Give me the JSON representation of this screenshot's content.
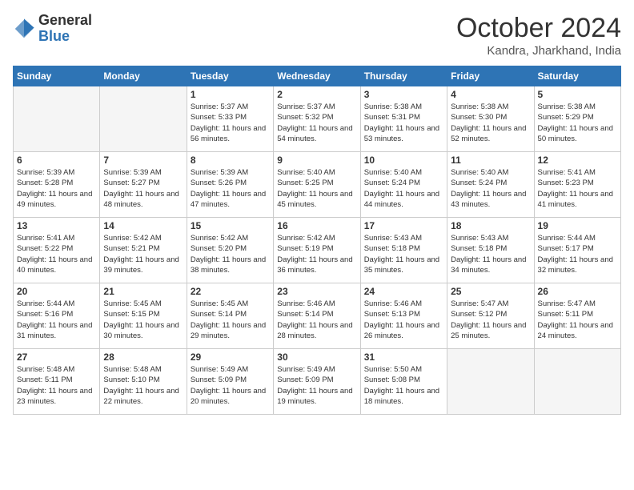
{
  "header": {
    "logo_general": "General",
    "logo_blue": "Blue",
    "month_year": "October 2024",
    "location": "Kandra, Jharkhand, India"
  },
  "days_of_week": [
    "Sunday",
    "Monday",
    "Tuesday",
    "Wednesday",
    "Thursday",
    "Friday",
    "Saturday"
  ],
  "weeks": [
    [
      {
        "day": "",
        "details": ""
      },
      {
        "day": "",
        "details": ""
      },
      {
        "day": "1",
        "details": "Sunrise: 5:37 AM\nSunset: 5:33 PM\nDaylight: 11 hours and 56 minutes."
      },
      {
        "day": "2",
        "details": "Sunrise: 5:37 AM\nSunset: 5:32 PM\nDaylight: 11 hours and 54 minutes."
      },
      {
        "day": "3",
        "details": "Sunrise: 5:38 AM\nSunset: 5:31 PM\nDaylight: 11 hours and 53 minutes."
      },
      {
        "day": "4",
        "details": "Sunrise: 5:38 AM\nSunset: 5:30 PM\nDaylight: 11 hours and 52 minutes."
      },
      {
        "day": "5",
        "details": "Sunrise: 5:38 AM\nSunset: 5:29 PM\nDaylight: 11 hours and 50 minutes."
      }
    ],
    [
      {
        "day": "6",
        "details": "Sunrise: 5:39 AM\nSunset: 5:28 PM\nDaylight: 11 hours and 49 minutes."
      },
      {
        "day": "7",
        "details": "Sunrise: 5:39 AM\nSunset: 5:27 PM\nDaylight: 11 hours and 48 minutes."
      },
      {
        "day": "8",
        "details": "Sunrise: 5:39 AM\nSunset: 5:26 PM\nDaylight: 11 hours and 47 minutes."
      },
      {
        "day": "9",
        "details": "Sunrise: 5:40 AM\nSunset: 5:25 PM\nDaylight: 11 hours and 45 minutes."
      },
      {
        "day": "10",
        "details": "Sunrise: 5:40 AM\nSunset: 5:24 PM\nDaylight: 11 hours and 44 minutes."
      },
      {
        "day": "11",
        "details": "Sunrise: 5:40 AM\nSunset: 5:24 PM\nDaylight: 11 hours and 43 minutes."
      },
      {
        "day": "12",
        "details": "Sunrise: 5:41 AM\nSunset: 5:23 PM\nDaylight: 11 hours and 41 minutes."
      }
    ],
    [
      {
        "day": "13",
        "details": "Sunrise: 5:41 AM\nSunset: 5:22 PM\nDaylight: 11 hours and 40 minutes."
      },
      {
        "day": "14",
        "details": "Sunrise: 5:42 AM\nSunset: 5:21 PM\nDaylight: 11 hours and 39 minutes."
      },
      {
        "day": "15",
        "details": "Sunrise: 5:42 AM\nSunset: 5:20 PM\nDaylight: 11 hours and 38 minutes."
      },
      {
        "day": "16",
        "details": "Sunrise: 5:42 AM\nSunset: 5:19 PM\nDaylight: 11 hours and 36 minutes."
      },
      {
        "day": "17",
        "details": "Sunrise: 5:43 AM\nSunset: 5:18 PM\nDaylight: 11 hours and 35 minutes."
      },
      {
        "day": "18",
        "details": "Sunrise: 5:43 AM\nSunset: 5:18 PM\nDaylight: 11 hours and 34 minutes."
      },
      {
        "day": "19",
        "details": "Sunrise: 5:44 AM\nSunset: 5:17 PM\nDaylight: 11 hours and 32 minutes."
      }
    ],
    [
      {
        "day": "20",
        "details": "Sunrise: 5:44 AM\nSunset: 5:16 PM\nDaylight: 11 hours and 31 minutes."
      },
      {
        "day": "21",
        "details": "Sunrise: 5:45 AM\nSunset: 5:15 PM\nDaylight: 11 hours and 30 minutes."
      },
      {
        "day": "22",
        "details": "Sunrise: 5:45 AM\nSunset: 5:14 PM\nDaylight: 11 hours and 29 minutes."
      },
      {
        "day": "23",
        "details": "Sunrise: 5:46 AM\nSunset: 5:14 PM\nDaylight: 11 hours and 28 minutes."
      },
      {
        "day": "24",
        "details": "Sunrise: 5:46 AM\nSunset: 5:13 PM\nDaylight: 11 hours and 26 minutes."
      },
      {
        "day": "25",
        "details": "Sunrise: 5:47 AM\nSunset: 5:12 PM\nDaylight: 11 hours and 25 minutes."
      },
      {
        "day": "26",
        "details": "Sunrise: 5:47 AM\nSunset: 5:11 PM\nDaylight: 11 hours and 24 minutes."
      }
    ],
    [
      {
        "day": "27",
        "details": "Sunrise: 5:48 AM\nSunset: 5:11 PM\nDaylight: 11 hours and 23 minutes."
      },
      {
        "day": "28",
        "details": "Sunrise: 5:48 AM\nSunset: 5:10 PM\nDaylight: 11 hours and 22 minutes."
      },
      {
        "day": "29",
        "details": "Sunrise: 5:49 AM\nSunset: 5:09 PM\nDaylight: 11 hours and 20 minutes."
      },
      {
        "day": "30",
        "details": "Sunrise: 5:49 AM\nSunset: 5:09 PM\nDaylight: 11 hours and 19 minutes."
      },
      {
        "day": "31",
        "details": "Sunrise: 5:50 AM\nSunset: 5:08 PM\nDaylight: 11 hours and 18 minutes."
      },
      {
        "day": "",
        "details": ""
      },
      {
        "day": "",
        "details": ""
      }
    ]
  ]
}
